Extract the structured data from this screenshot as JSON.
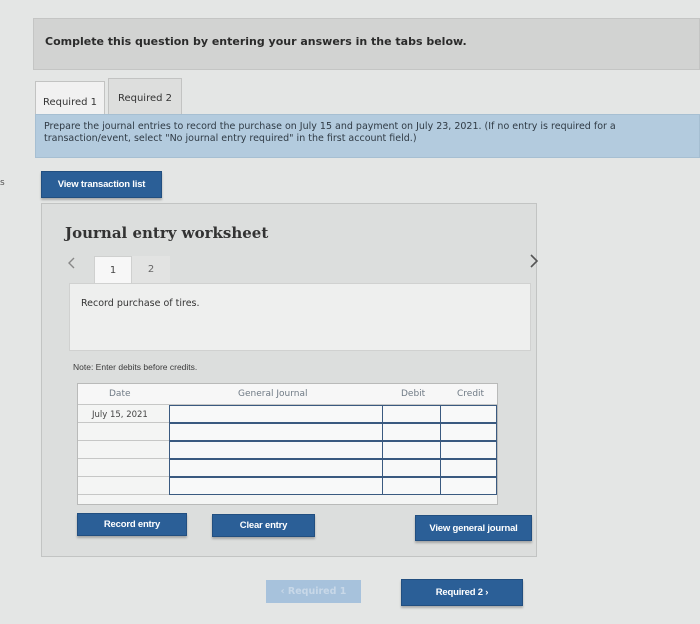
{
  "edge_mark": "s",
  "header": {
    "text": "Complete this question by entering your answers in the tabs below."
  },
  "tabs": [
    {
      "label": "Required 1",
      "active": true
    },
    {
      "label": "Required 2",
      "active": false
    }
  ],
  "instructions": {
    "line1": "Prepare the journal entries to record the purchase on July 15 and payment on July 23, 2021. (If no entry is required for a",
    "line2": "transaction/event, select \"No journal entry required\" in the first account field.)"
  },
  "view_transaction_label": "View transaction list",
  "worksheet": {
    "title": "Journal entry worksheet",
    "prev_icon": "chevron-left-icon",
    "next_icon": "chevron-right-icon",
    "pages": [
      "1",
      "2"
    ],
    "active_page": "1",
    "description": "Record purchase of tires.",
    "note": "Note: Enter debits before credits."
  },
  "journal_table": {
    "columns": [
      "Date",
      "General Journal",
      "Debit",
      "Credit"
    ],
    "rows": [
      {
        "date": "July 15, 2021",
        "account": "",
        "debit": "",
        "credit": ""
      },
      {
        "date": "",
        "account": "",
        "debit": "",
        "credit": ""
      },
      {
        "date": "",
        "account": "",
        "debit": "",
        "credit": ""
      },
      {
        "date": "",
        "account": "",
        "debit": "",
        "credit": ""
      },
      {
        "date": "",
        "account": "",
        "debit": "",
        "credit": ""
      },
      {
        "date": "",
        "account": "",
        "debit": "",
        "credit": ""
      }
    ]
  },
  "buttons": {
    "record_entry": "Record entry",
    "clear_entry": "Clear entry",
    "view_general_journal": "View general journal",
    "prev_required": "‹  Required 1",
    "next_required": "Required 2  ›"
  },
  "colors": {
    "accent": "#2b5f97",
    "instruction_bg": "#b3cbde",
    "disabled_button": "#a7c2dc"
  }
}
